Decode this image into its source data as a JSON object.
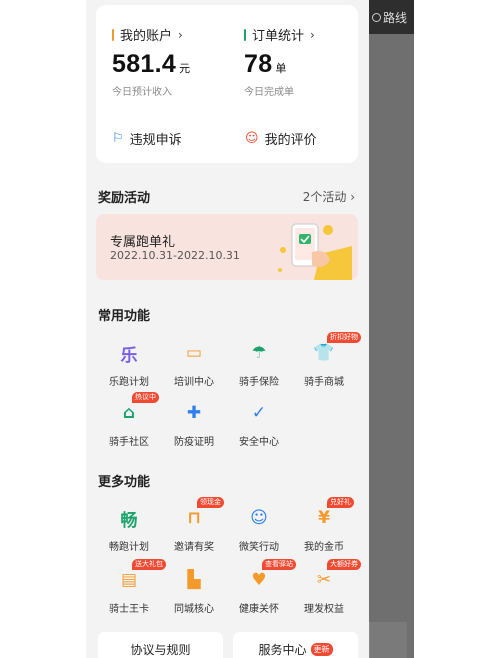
{
  "topbar": {
    "route_label": "路线"
  },
  "account": {
    "my_account": {
      "label": "我的账户",
      "value": "581.4",
      "unit": "元",
      "sub": "今日预计收入"
    },
    "orders": {
      "label": "订单统计",
      "value": "78",
      "unit": "单",
      "sub": "今日完成单"
    },
    "appeal": "违规申诉",
    "review": "我的评价"
  },
  "rewards": {
    "title": "奖励活动",
    "more": "2个活动",
    "banner_title": "专属跑单礼",
    "banner_dates": "2022.10.31-2022.10.31"
  },
  "common": {
    "title": "常用功能",
    "items": [
      {
        "label": "乐跑计划",
        "glyph": "乐",
        "color": "#7b5fe3",
        "tag": ""
      },
      {
        "label": "培训中心",
        "glyph": "▭",
        "color": "#f39a2b",
        "tag": ""
      },
      {
        "label": "骑手保险",
        "glyph": "☂",
        "color": "#1ba36b",
        "tag": ""
      },
      {
        "label": "骑手商城",
        "glyph": "👕",
        "color": "#f39a2b",
        "tag": "折扣好物"
      },
      {
        "label": "骑手社区",
        "glyph": "⌂",
        "color": "#1ba36b",
        "tag": "热议中"
      },
      {
        "label": "防疫证明",
        "glyph": "✚",
        "color": "#2f80ed",
        "tag": ""
      },
      {
        "label": "安全中心",
        "glyph": "✓",
        "color": "#2f80ed",
        "tag": ""
      }
    ]
  },
  "more": {
    "title": "更多功能",
    "items": [
      {
        "label": "畅跑计划",
        "glyph": "畅",
        "color": "#1ba36b",
        "tag": ""
      },
      {
        "label": "邀请有奖",
        "glyph": "⊓",
        "color": "#f39a2b",
        "tag": "领现金"
      },
      {
        "label": "微笑行动",
        "glyph": "☺",
        "color": "#2f80ed",
        "tag": ""
      },
      {
        "label": "我的金币",
        "glyph": "¥",
        "color": "#f39a2b",
        "tag": "兑好礼"
      },
      {
        "label": "骑士王卡",
        "glyph": "▤",
        "color": "#f39a2b",
        "tag": "送大礼包"
      },
      {
        "label": "同城核心",
        "glyph": "▙",
        "color": "#f39a2b",
        "tag": ""
      },
      {
        "label": "健康关怀",
        "glyph": "♥",
        "color": "#f39a2b",
        "tag": "查看驿站"
      },
      {
        "label": "理发权益",
        "glyph": "✂",
        "color": "#f39a2b",
        "tag": "大额好券"
      }
    ]
  },
  "footer": {
    "rules": "协议与规则",
    "service": "服务中心",
    "service_tag": "更新"
  }
}
